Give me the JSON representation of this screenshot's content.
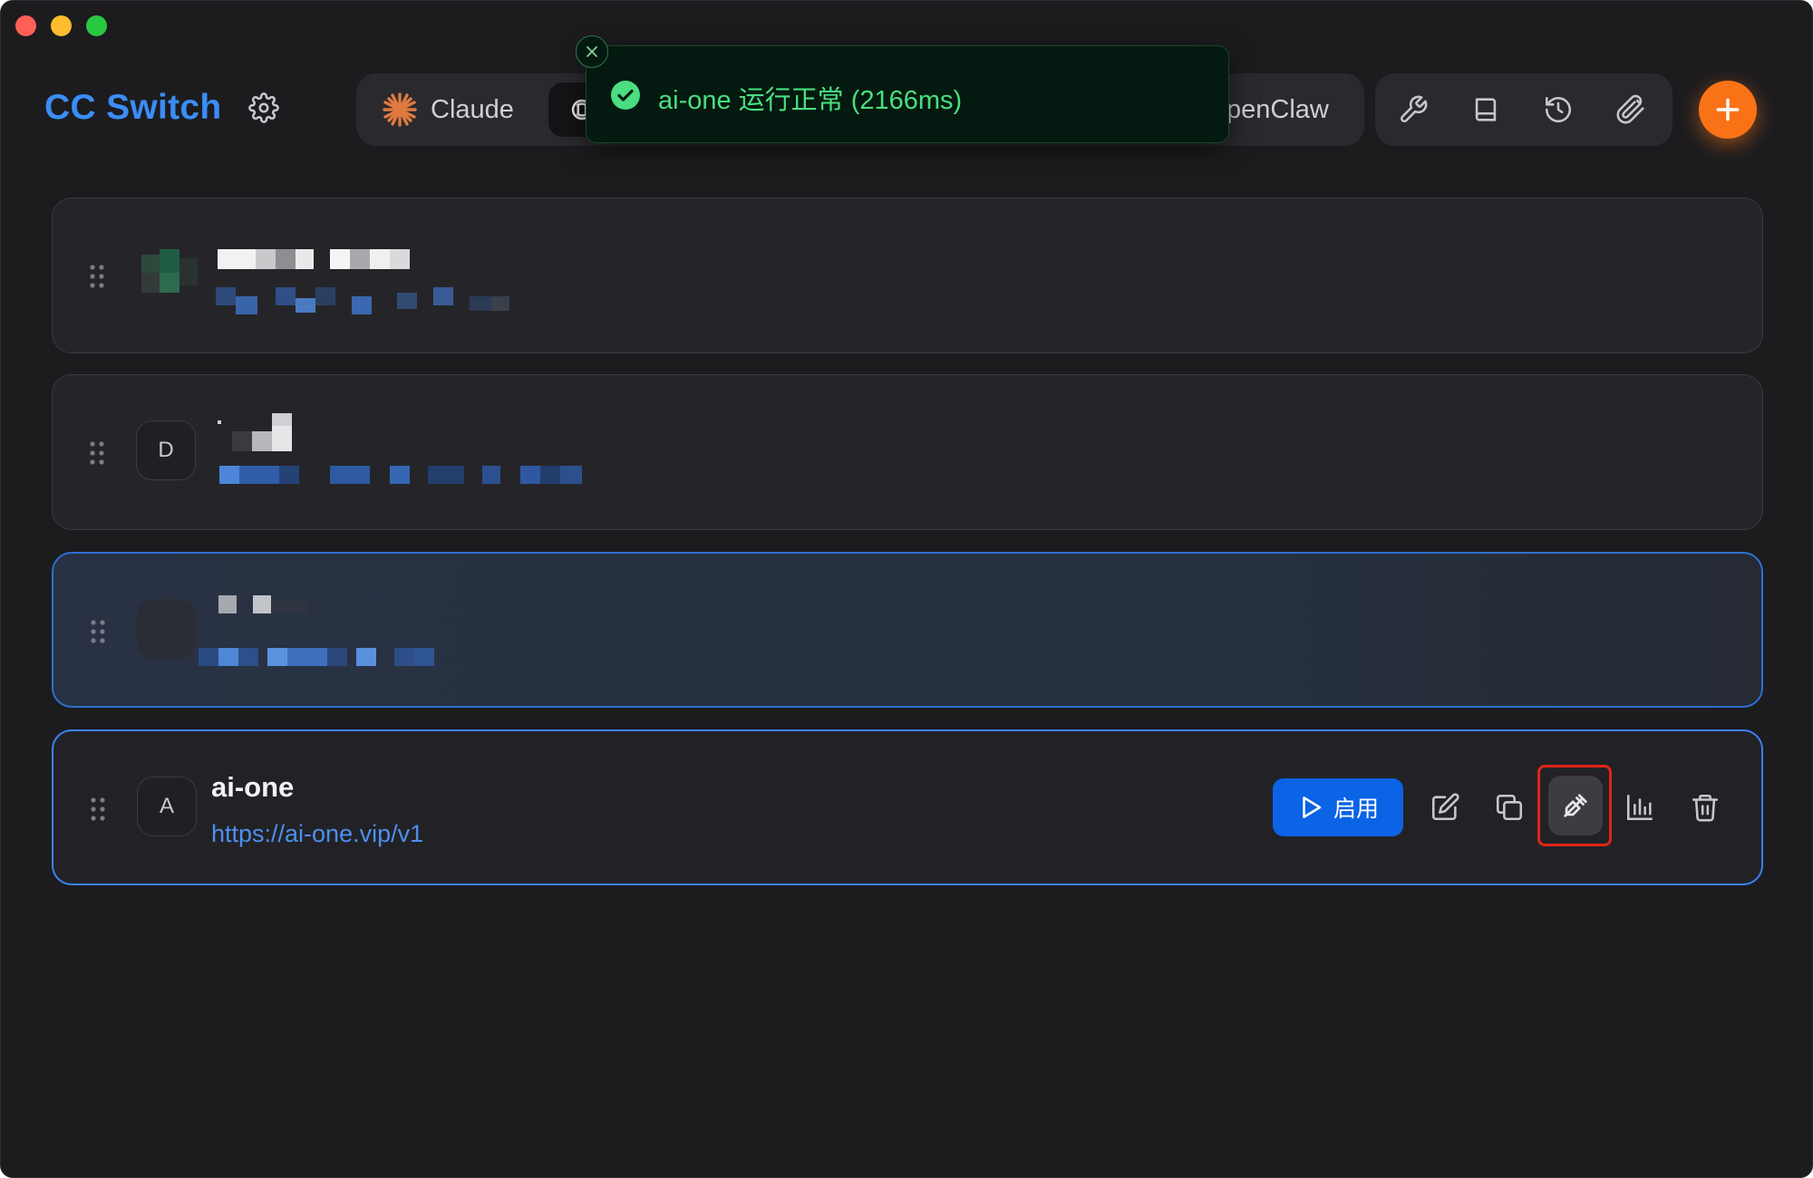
{
  "app": {
    "title": "CC Switch"
  },
  "tabs": {
    "claude_label": "Claude",
    "openclaw_label": "penClaw"
  },
  "toast": {
    "message": "ai-one 运行正常 (2166ms)"
  },
  "providers": [
    {
      "name": "",
      "url": "",
      "avatar": ""
    },
    {
      "name": "",
      "url": "",
      "avatar": "D"
    },
    {
      "name": "",
      "url": "",
      "avatar": ""
    },
    {
      "name": "ai-one",
      "url": "https://ai-one.vip/v1",
      "avatar": "A"
    }
  ],
  "actions": {
    "enable_label": "启用"
  },
  "colors": {
    "brand": "#3b8df5",
    "accent_orange": "#f97316",
    "primary_button": "#0b63e5",
    "success": "#4ade80",
    "highlight_box": "#e02416"
  },
  "icons": {
    "settings": "gear-icon",
    "claude": "claude-logo-icon",
    "codex": "codex-logo-icon",
    "tools": [
      "wrench-icon",
      "book-icon",
      "history-icon",
      "paperclip-icon"
    ],
    "add": "plus-icon",
    "card_actions": [
      "edit-icon",
      "copy-icon",
      "test-icon",
      "usage-chart-icon",
      "trash-icon"
    ]
  }
}
